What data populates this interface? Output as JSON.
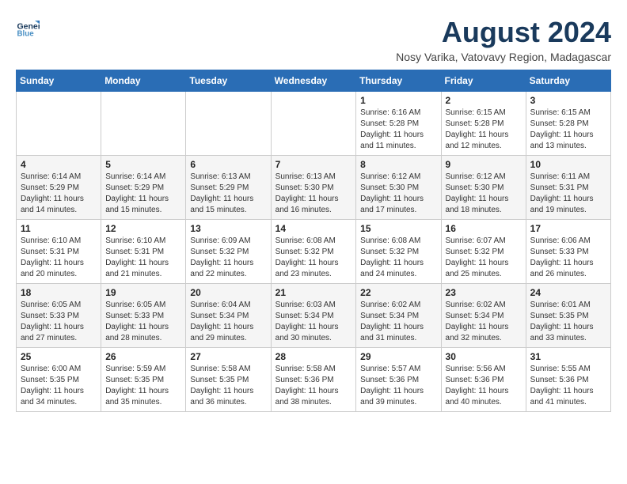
{
  "header": {
    "logo_line1": "General",
    "logo_line2": "Blue",
    "month_year": "August 2024",
    "location": "Nosy Varika, Vatovavy Region, Madagascar"
  },
  "weekdays": [
    "Sunday",
    "Monday",
    "Tuesday",
    "Wednesday",
    "Thursday",
    "Friday",
    "Saturday"
  ],
  "weeks": [
    [
      {
        "day": "",
        "info": ""
      },
      {
        "day": "",
        "info": ""
      },
      {
        "day": "",
        "info": ""
      },
      {
        "day": "",
        "info": ""
      },
      {
        "day": "1",
        "info": "Sunrise: 6:16 AM\nSunset: 5:28 PM\nDaylight: 11 hours\nand 11 minutes."
      },
      {
        "day": "2",
        "info": "Sunrise: 6:15 AM\nSunset: 5:28 PM\nDaylight: 11 hours\nand 12 minutes."
      },
      {
        "day": "3",
        "info": "Sunrise: 6:15 AM\nSunset: 5:28 PM\nDaylight: 11 hours\nand 13 minutes."
      }
    ],
    [
      {
        "day": "4",
        "info": "Sunrise: 6:14 AM\nSunset: 5:29 PM\nDaylight: 11 hours\nand 14 minutes."
      },
      {
        "day": "5",
        "info": "Sunrise: 6:14 AM\nSunset: 5:29 PM\nDaylight: 11 hours\nand 15 minutes."
      },
      {
        "day": "6",
        "info": "Sunrise: 6:13 AM\nSunset: 5:29 PM\nDaylight: 11 hours\nand 15 minutes."
      },
      {
        "day": "7",
        "info": "Sunrise: 6:13 AM\nSunset: 5:30 PM\nDaylight: 11 hours\nand 16 minutes."
      },
      {
        "day": "8",
        "info": "Sunrise: 6:12 AM\nSunset: 5:30 PM\nDaylight: 11 hours\nand 17 minutes."
      },
      {
        "day": "9",
        "info": "Sunrise: 6:12 AM\nSunset: 5:30 PM\nDaylight: 11 hours\nand 18 minutes."
      },
      {
        "day": "10",
        "info": "Sunrise: 6:11 AM\nSunset: 5:31 PM\nDaylight: 11 hours\nand 19 minutes."
      }
    ],
    [
      {
        "day": "11",
        "info": "Sunrise: 6:10 AM\nSunset: 5:31 PM\nDaylight: 11 hours\nand 20 minutes."
      },
      {
        "day": "12",
        "info": "Sunrise: 6:10 AM\nSunset: 5:31 PM\nDaylight: 11 hours\nand 21 minutes."
      },
      {
        "day": "13",
        "info": "Sunrise: 6:09 AM\nSunset: 5:32 PM\nDaylight: 11 hours\nand 22 minutes."
      },
      {
        "day": "14",
        "info": "Sunrise: 6:08 AM\nSunset: 5:32 PM\nDaylight: 11 hours\nand 23 minutes."
      },
      {
        "day": "15",
        "info": "Sunrise: 6:08 AM\nSunset: 5:32 PM\nDaylight: 11 hours\nand 24 minutes."
      },
      {
        "day": "16",
        "info": "Sunrise: 6:07 AM\nSunset: 5:32 PM\nDaylight: 11 hours\nand 25 minutes."
      },
      {
        "day": "17",
        "info": "Sunrise: 6:06 AM\nSunset: 5:33 PM\nDaylight: 11 hours\nand 26 minutes."
      }
    ],
    [
      {
        "day": "18",
        "info": "Sunrise: 6:05 AM\nSunset: 5:33 PM\nDaylight: 11 hours\nand 27 minutes."
      },
      {
        "day": "19",
        "info": "Sunrise: 6:05 AM\nSunset: 5:33 PM\nDaylight: 11 hours\nand 28 minutes."
      },
      {
        "day": "20",
        "info": "Sunrise: 6:04 AM\nSunset: 5:34 PM\nDaylight: 11 hours\nand 29 minutes."
      },
      {
        "day": "21",
        "info": "Sunrise: 6:03 AM\nSunset: 5:34 PM\nDaylight: 11 hours\nand 30 minutes."
      },
      {
        "day": "22",
        "info": "Sunrise: 6:02 AM\nSunset: 5:34 PM\nDaylight: 11 hours\nand 31 minutes."
      },
      {
        "day": "23",
        "info": "Sunrise: 6:02 AM\nSunset: 5:34 PM\nDaylight: 11 hours\nand 32 minutes."
      },
      {
        "day": "24",
        "info": "Sunrise: 6:01 AM\nSunset: 5:35 PM\nDaylight: 11 hours\nand 33 minutes."
      }
    ],
    [
      {
        "day": "25",
        "info": "Sunrise: 6:00 AM\nSunset: 5:35 PM\nDaylight: 11 hours\nand 34 minutes."
      },
      {
        "day": "26",
        "info": "Sunrise: 5:59 AM\nSunset: 5:35 PM\nDaylight: 11 hours\nand 35 minutes."
      },
      {
        "day": "27",
        "info": "Sunrise: 5:58 AM\nSunset: 5:35 PM\nDaylight: 11 hours\nand 36 minutes."
      },
      {
        "day": "28",
        "info": "Sunrise: 5:58 AM\nSunset: 5:36 PM\nDaylight: 11 hours\nand 38 minutes."
      },
      {
        "day": "29",
        "info": "Sunrise: 5:57 AM\nSunset: 5:36 PM\nDaylight: 11 hours\nand 39 minutes."
      },
      {
        "day": "30",
        "info": "Sunrise: 5:56 AM\nSunset: 5:36 PM\nDaylight: 11 hours\nand 40 minutes."
      },
      {
        "day": "31",
        "info": "Sunrise: 5:55 AM\nSunset: 5:36 PM\nDaylight: 11 hours\nand 41 minutes."
      }
    ]
  ]
}
